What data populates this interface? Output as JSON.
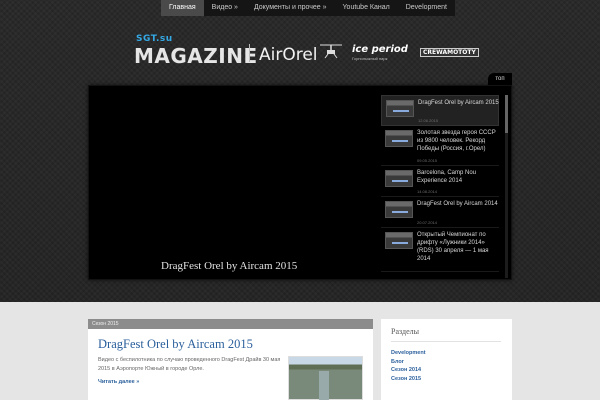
{
  "nav": {
    "items": [
      {
        "label": "Главная",
        "active": true
      },
      {
        "label": "Видео »",
        "active": false
      },
      {
        "label": "Документы и прочее »",
        "active": false
      },
      {
        "label": "Youtube Канал",
        "active": false
      },
      {
        "label": "Development",
        "active": false
      }
    ]
  },
  "logo": {
    "site": "SGT.su",
    "magazine": "MAGAZINE",
    "partner1": "AirOrel",
    "partner2": "ice period",
    "partner2_sub": "Горнолыжный парк",
    "partner3": "CREWAMOTOTY"
  },
  "slider": {
    "top_label": "топ",
    "main_title": "DragFest Orel by Aircam 2015",
    "items": [
      {
        "title": "DragFest Orel by Aircam 2015",
        "date": "12.06.2015",
        "active": true
      },
      {
        "title": "Золотая звезда героя СССР из 9800 человек. Рекорд Победы (Россия, г.Орел)",
        "date": "09.05.2015",
        "active": false
      },
      {
        "title": "Barcelona, Camp Nou Experience 2014",
        "date": "14.08.2014",
        "active": false
      },
      {
        "title": "DragFest Orel by Aircam 2014",
        "date": "20.07.2014",
        "active": false
      },
      {
        "title": "Открытый Чемпионат по дрифту «Лужники 2014» (RDS) 30 апреля — 1 мая 2014",
        "date": "",
        "active": false
      }
    ]
  },
  "post": {
    "category": "Сезон 2015",
    "title": "DragFest Orel by Aircam 2015",
    "excerpt": "Видео с беспилотника по случаю проведенного DragFest Драйв 30 мая 2015 в Аэропорте Южный в городе Орле.",
    "read_more": "Читать далее »"
  },
  "sidebar": {
    "title": "Разделы",
    "items": [
      "Development",
      "Блог",
      "Сезон 2014",
      "Сезон 2015"
    ]
  }
}
